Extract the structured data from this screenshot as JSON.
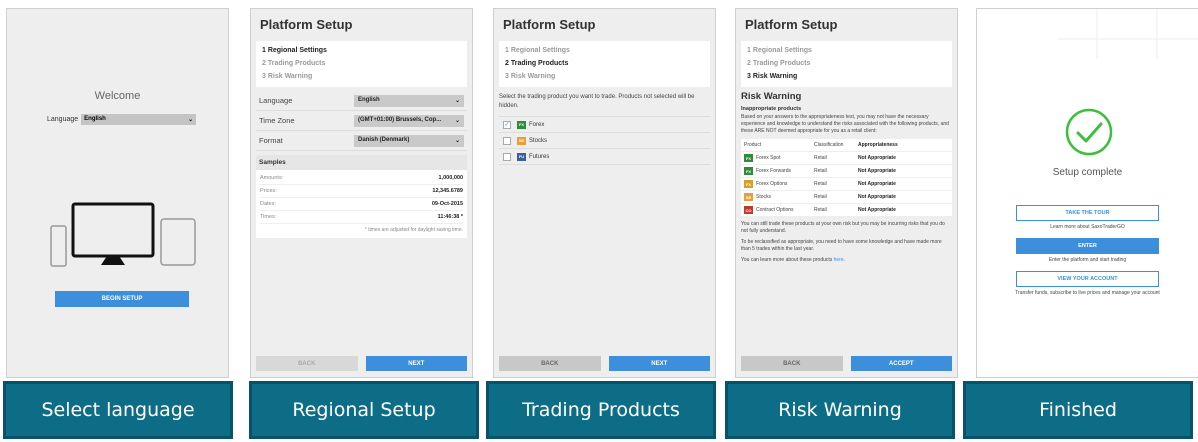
{
  "captions": [
    "Select language",
    "Regional Setup",
    "Trading Products",
    "Risk Warning",
    "Finished"
  ],
  "screen1": {
    "welcome": "Welcome",
    "language_label": "Language",
    "language_value": "English",
    "begin_button": "BEGIN SETUP"
  },
  "platform_title": "Platform Setup",
  "steps": [
    "1 Regional Settings",
    "2 Trading Products",
    "3 Risk Warning"
  ],
  "screen2": {
    "fields": [
      {
        "label": "Language",
        "value": "English"
      },
      {
        "label": "Time Zone",
        "value": "(GMT+01:00) Brussels, Cop..."
      },
      {
        "label": "Format",
        "value": "Danish (Denmark)"
      }
    ],
    "samples_title": "Samples",
    "samples": [
      {
        "label": "Amounts:",
        "value": "1,000,000"
      },
      {
        "label": "Prices:",
        "value": "12,345.6789"
      },
      {
        "label": "Dates:",
        "value": "09-Oct-2015"
      },
      {
        "label": "Times:",
        "value": "11:46:38 *"
      }
    ],
    "note": "* times are adjusted for daylight saving time.",
    "back": "BACK",
    "next": "NEXT"
  },
  "screen3": {
    "description": "Select the trading product you want to trade. Products not selected will be hidden.",
    "products": [
      {
        "tag": "FX",
        "name": "Forex",
        "checked": "✓",
        "color": "#2e8b3a"
      },
      {
        "tag": "SE",
        "name": "Stocks",
        "checked": "",
        "color": "#e8a13a"
      },
      {
        "tag": "FU",
        "name": "Futures",
        "checked": "",
        "color": "#3b5f9e"
      }
    ],
    "back": "BACK",
    "next": "NEXT"
  },
  "screen4": {
    "heading": "Risk Warning",
    "subheading": "Inappropriate products",
    "intro": "Based on your answers to the appropriateness test, you may not have the necessary experience and knowledge to understand the risks associated with the following products, and these ARE NOT deemed appropriate for you as a retail client:",
    "columns": [
      "Product",
      "Classification",
      "Appropriateness"
    ],
    "rows": [
      {
        "tag": "FX",
        "color": "#2e8b3a",
        "product": "Forex Spot",
        "classification": "Retail",
        "appropriateness": "Not Appropriate"
      },
      {
        "tag": "FX",
        "color": "#2e8b3a",
        "product": "Forex Forwards",
        "classification": "Retail",
        "appropriateness": "Not Appropriate"
      },
      {
        "tag": "FX",
        "color": "#d4a21f",
        "product": "Forex Options",
        "classification": "Retail",
        "appropriateness": "Not Appropriate"
      },
      {
        "tag": "SE",
        "color": "#e8a13a",
        "product": "Stocks",
        "classification": "Retail",
        "appropriateness": "Not Appropriate"
      },
      {
        "tag": "CO",
        "color": "#c0392b",
        "product": "Contract Options",
        "classification": "Retail",
        "appropriateness": "Not Appropriate"
      }
    ],
    "para1": "You can still trade these products at your own risk but you may be incurring risks that you do not fully understand.",
    "para2": "To be reclassified as appropriate, you need to have some knowledge and have made more than 5 trades within the last year.",
    "para3_prefix": "You can learn more about these products ",
    "para3_link": "here.",
    "back": "BACK",
    "accept": "ACCEPT"
  },
  "screen5": {
    "title": "Setup complete",
    "tour_button": "TAKE THE TOUR",
    "tour_note": "Learn more about SaxoTraderGO",
    "enter_button": "ENTER",
    "enter_note": "Enter the platform and start trading",
    "account_button": "VIEW YOUR ACCOUNT",
    "account_note": "Transfer funds, subscribe to live prices and manage your account"
  },
  "colors": {
    "accent": "#3d8fdb",
    "caption_bg": "#0d6d86",
    "success": "#3cbf3c"
  }
}
